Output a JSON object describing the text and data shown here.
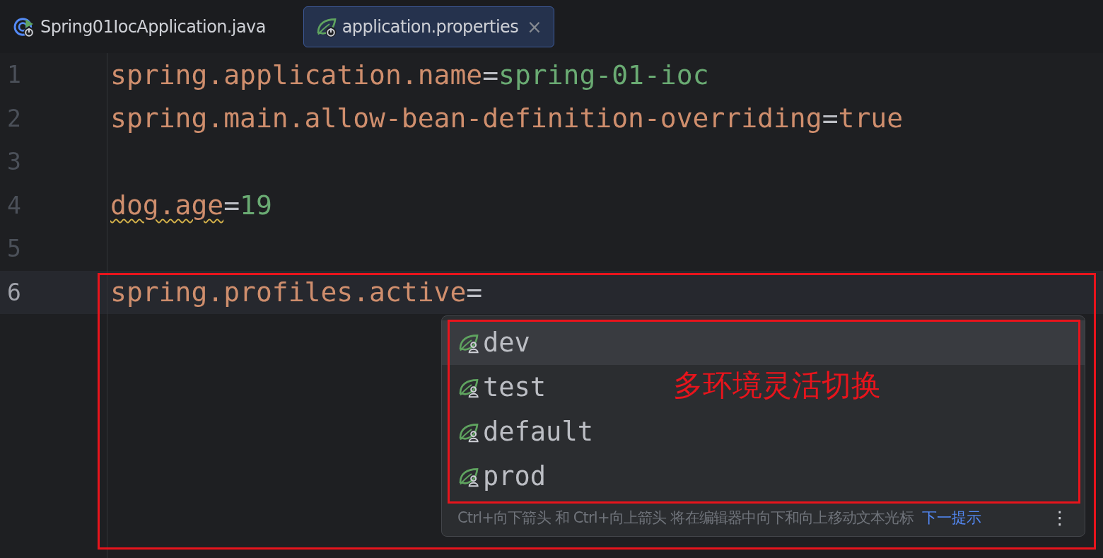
{
  "tabs": [
    {
      "label": "Spring01IocApplication.java",
      "kind": "java",
      "selected": false,
      "closable": false
    },
    {
      "label": "application.properties",
      "kind": "properties",
      "selected": true,
      "closable": true,
      "close_glyph": "×"
    }
  ],
  "editor": {
    "lines": [
      {
        "number": "1",
        "current": false,
        "tokens": [
          {
            "kind": "key",
            "text": "spring.application.name"
          },
          {
            "kind": "sep",
            "text": "="
          },
          {
            "kind": "value",
            "text": "spring-01-ioc"
          }
        ]
      },
      {
        "number": "2",
        "current": false,
        "tokens": [
          {
            "kind": "key",
            "text": "spring.main.allow-bean-definition-overriding"
          },
          {
            "kind": "sep",
            "text": "="
          },
          {
            "kind": "key",
            "text": "true"
          }
        ]
      },
      {
        "number": "3",
        "current": false
      },
      {
        "number": "4",
        "current": false,
        "tokens": [
          {
            "kind": "key",
            "text": "dog.age",
            "warning": true
          },
          {
            "kind": "sep",
            "text": "="
          },
          {
            "kind": "value",
            "text": "19"
          }
        ]
      },
      {
        "number": "5",
        "current": false
      },
      {
        "number": "6",
        "current": true,
        "tokens": [
          {
            "kind": "key",
            "text": "spring.profiles.active"
          },
          {
            "kind": "sep",
            "text": "="
          }
        ]
      }
    ]
  },
  "completion": {
    "items": [
      {
        "label": "dev",
        "selected": true
      },
      {
        "label": "test",
        "selected": false
      },
      {
        "label": "default",
        "selected": false
      },
      {
        "label": "prod",
        "selected": false
      }
    ],
    "footer": {
      "hint": "Ctrl+向下箭头 和 Ctrl+向上箭头 将在编辑器中向下和向上移动文本光标",
      "link": "下一提示",
      "menu_glyph": "⋮"
    }
  },
  "annotation": {
    "text": "多环境灵活切换"
  }
}
